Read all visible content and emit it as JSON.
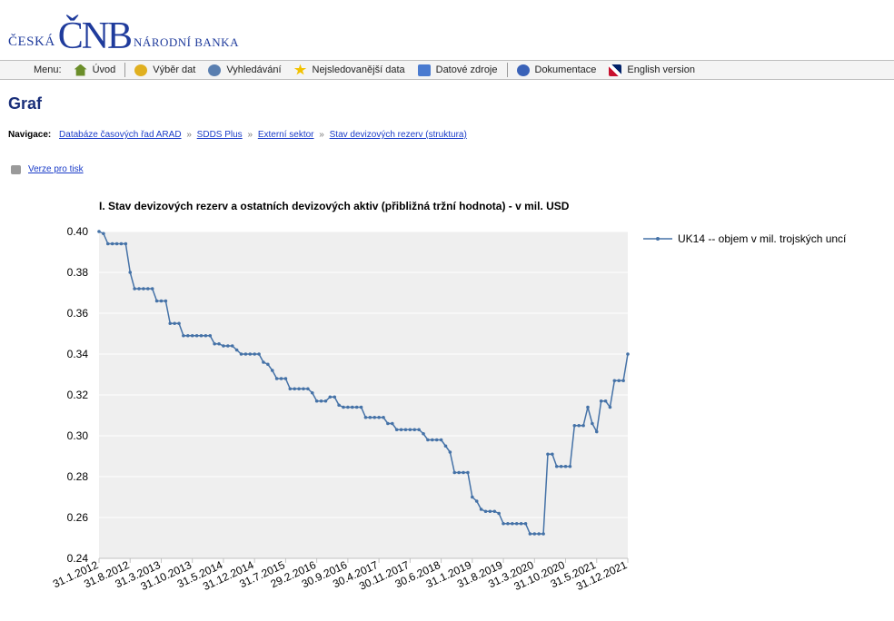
{
  "logo": {
    "left": "ČESKÁ",
    "mark": "ČNB",
    "right": "NÁRODNÍ BANKA"
  },
  "menu": {
    "label": "Menu:",
    "items": [
      {
        "label": "Úvod",
        "icon": "home-icon"
      },
      {
        "label": "Výběr dat",
        "icon": "data-select-icon"
      },
      {
        "label": "Vyhledávání",
        "icon": "search-icon"
      },
      {
        "label": "Nejsledovanější data",
        "icon": "star-icon"
      },
      {
        "label": "Datové zdroje",
        "icon": "data-sources-icon"
      },
      {
        "label": "Dokumentace",
        "icon": "documentation-icon"
      },
      {
        "label": "English version",
        "icon": "uk-flag-icon"
      }
    ]
  },
  "page": {
    "heading": "Graf",
    "nav_label": "Navigace:",
    "breadcrumb": [
      "Databáze časových řad ARAD",
      "SDDS Plus",
      "Externí sektor",
      "Stav devizových rezerv (struktura)"
    ],
    "breadcrumb_sep": "»",
    "print_link": "Verze pro tisk"
  },
  "chart_data": {
    "type": "line",
    "title": "I. Stav devizových rezerv a ostatních devizových aktiv (přibližná tržní hodnota) - v mil. USD",
    "ylim": [
      0.24,
      0.4
    ],
    "yticks": [
      "0.40",
      "0.38",
      "0.36",
      "0.34",
      "0.32",
      "0.30",
      "0.28",
      "0.26",
      "0.24"
    ],
    "xtick_labels": [
      "31.1.2012",
      "31.8.2012",
      "31.3.2013",
      "31.10.2013",
      "31.5.2014",
      "31.12.2014",
      "31.7.2015",
      "29.2.2016",
      "30.9.2016",
      "30.4.2017",
      "30.11.2017",
      "30.6.2018",
      "31.1.2019",
      "31.8.2019",
      "31.3.2020",
      "31.10.2020",
      "31.5.2021",
      "31.12.2021"
    ],
    "grid": true,
    "legend_position": "right",
    "line_color": "#4572A7",
    "series": [
      {
        "name": "UK14 -- objem v mil. trojských uncí",
        "values": [
          0.4,
          0.399,
          0.394,
          0.394,
          0.394,
          0.394,
          0.394,
          0.38,
          0.372,
          0.372,
          0.372,
          0.372,
          0.372,
          0.366,
          0.366,
          0.366,
          0.355,
          0.355,
          0.355,
          0.349,
          0.349,
          0.349,
          0.349,
          0.349,
          0.349,
          0.349,
          0.345,
          0.345,
          0.344,
          0.344,
          0.344,
          0.342,
          0.34,
          0.34,
          0.34,
          0.34,
          0.34,
          0.336,
          0.335,
          0.332,
          0.328,
          0.328,
          0.328,
          0.323,
          0.323,
          0.323,
          0.323,
          0.323,
          0.321,
          0.317,
          0.317,
          0.317,
          0.319,
          0.319,
          0.315,
          0.314,
          0.314,
          0.314,
          0.314,
          0.314,
          0.309,
          0.309,
          0.309,
          0.309,
          0.309,
          0.306,
          0.306,
          0.303,
          0.303,
          0.303,
          0.303,
          0.303,
          0.303,
          0.301,
          0.298,
          0.298,
          0.298,
          0.298,
          0.295,
          0.292,
          0.282,
          0.282,
          0.282,
          0.282,
          0.27,
          0.268,
          0.264,
          0.263,
          0.263,
          0.263,
          0.262,
          0.257,
          0.257,
          0.257,
          0.257,
          0.257,
          0.257,
          0.252,
          0.252,
          0.252,
          0.252,
          0.291,
          0.291,
          0.285,
          0.285,
          0.285,
          0.285,
          0.305,
          0.305,
          0.305,
          0.314,
          0.306,
          0.302,
          0.317,
          0.317,
          0.314,
          0.327,
          0.327,
          0.327,
          0.34
        ]
      }
    ]
  }
}
